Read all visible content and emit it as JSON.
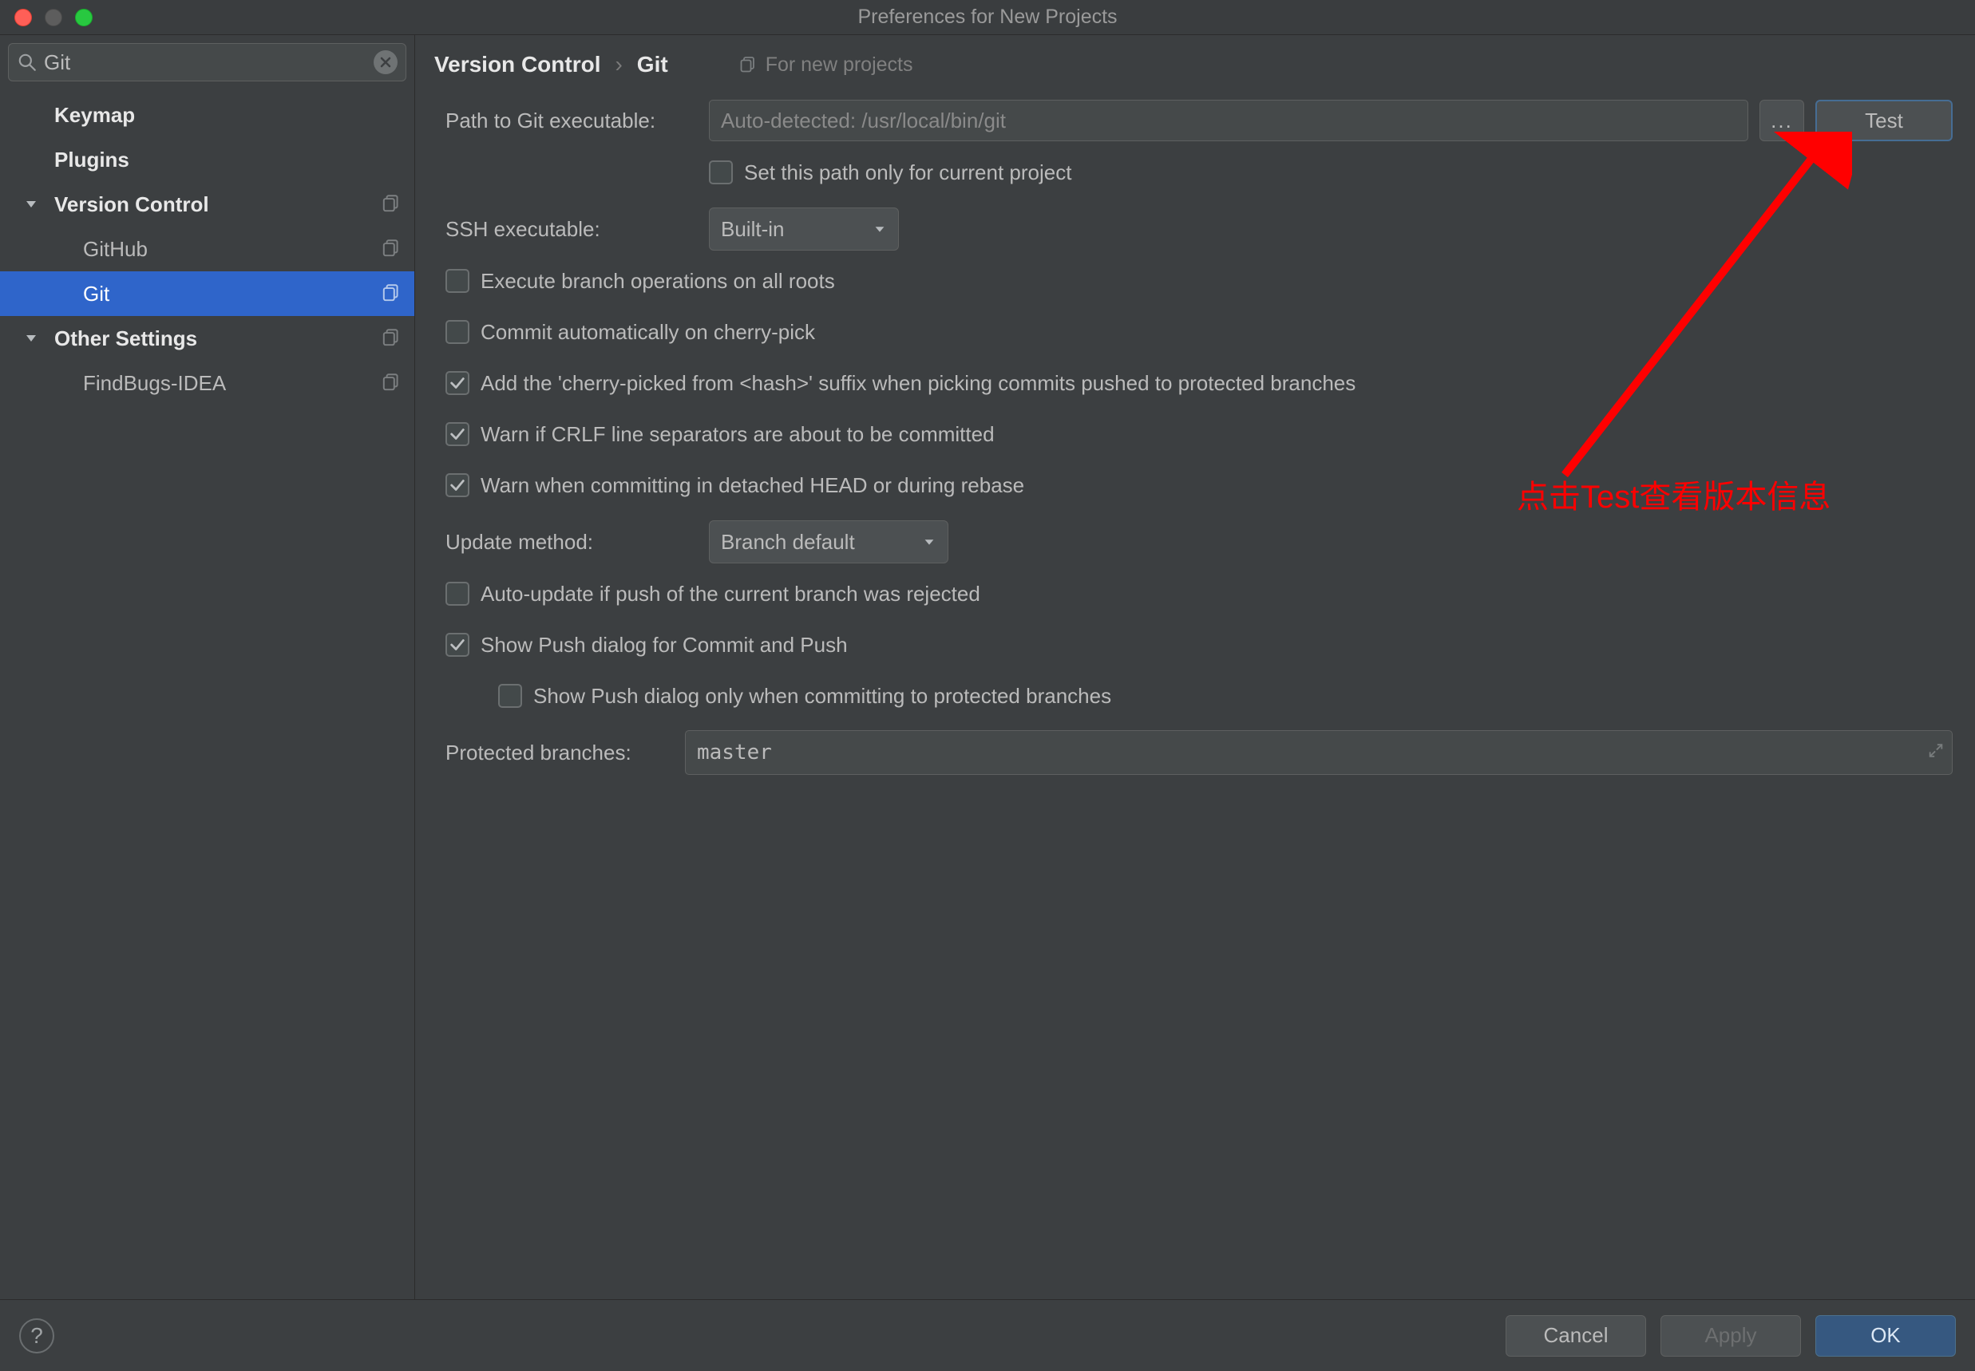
{
  "window": {
    "title": "Preferences for New Projects"
  },
  "search": {
    "value": "Git"
  },
  "sidebar": {
    "items": [
      {
        "label": "Keymap",
        "type": "top"
      },
      {
        "label": "Plugins",
        "type": "top"
      },
      {
        "label": "Version Control",
        "type": "group",
        "copyable": true
      },
      {
        "label": "GitHub",
        "type": "child",
        "copyable": true
      },
      {
        "label": "Git",
        "type": "child",
        "copyable": true,
        "selected": true
      },
      {
        "label": "Other Settings",
        "type": "group",
        "copyable": true
      },
      {
        "label": "FindBugs-IDEA",
        "type": "child",
        "copyable": true
      }
    ]
  },
  "breadcrumb": {
    "root": "Version Control",
    "leaf": "Git",
    "note": "For new projects"
  },
  "form": {
    "path_label": "Path to Git executable:",
    "path_placeholder": "Auto-detected: /usr/local/bin/git",
    "browse_label": "...",
    "test_label": "Test",
    "set_path_current": {
      "checked": false,
      "label": "Set this path only for current project"
    },
    "ssh_label": "SSH executable:",
    "ssh_value": "Built-in",
    "exec_branch": {
      "checked": false,
      "label": "Execute branch operations on all roots"
    },
    "commit_cherry": {
      "checked": false,
      "label": "Commit automatically on cherry-pick"
    },
    "add_suffix": {
      "checked": true,
      "label": "Add the 'cherry-picked from <hash>' suffix when picking commits pushed to protected branches"
    },
    "warn_crlf": {
      "checked": true,
      "label": "Warn if CRLF line separators are about to be committed"
    },
    "warn_detached": {
      "checked": true,
      "label": "Warn when committing in detached HEAD or during rebase"
    },
    "update_label": "Update method:",
    "update_value": "Branch default",
    "auto_update": {
      "checked": false,
      "label": "Auto-update if push of the current branch was rejected"
    },
    "show_push": {
      "checked": true,
      "label": "Show Push dialog for Commit and Push"
    },
    "show_push_protected": {
      "checked": false,
      "label": "Show Push dialog only when committing to protected branches"
    },
    "protected_label": "Protected branches:",
    "protected_value": "master"
  },
  "footer": {
    "help": "?",
    "cancel": "Cancel",
    "apply": "Apply",
    "ok": "OK"
  },
  "annotation": {
    "text": "点击Test查看版本信息"
  }
}
